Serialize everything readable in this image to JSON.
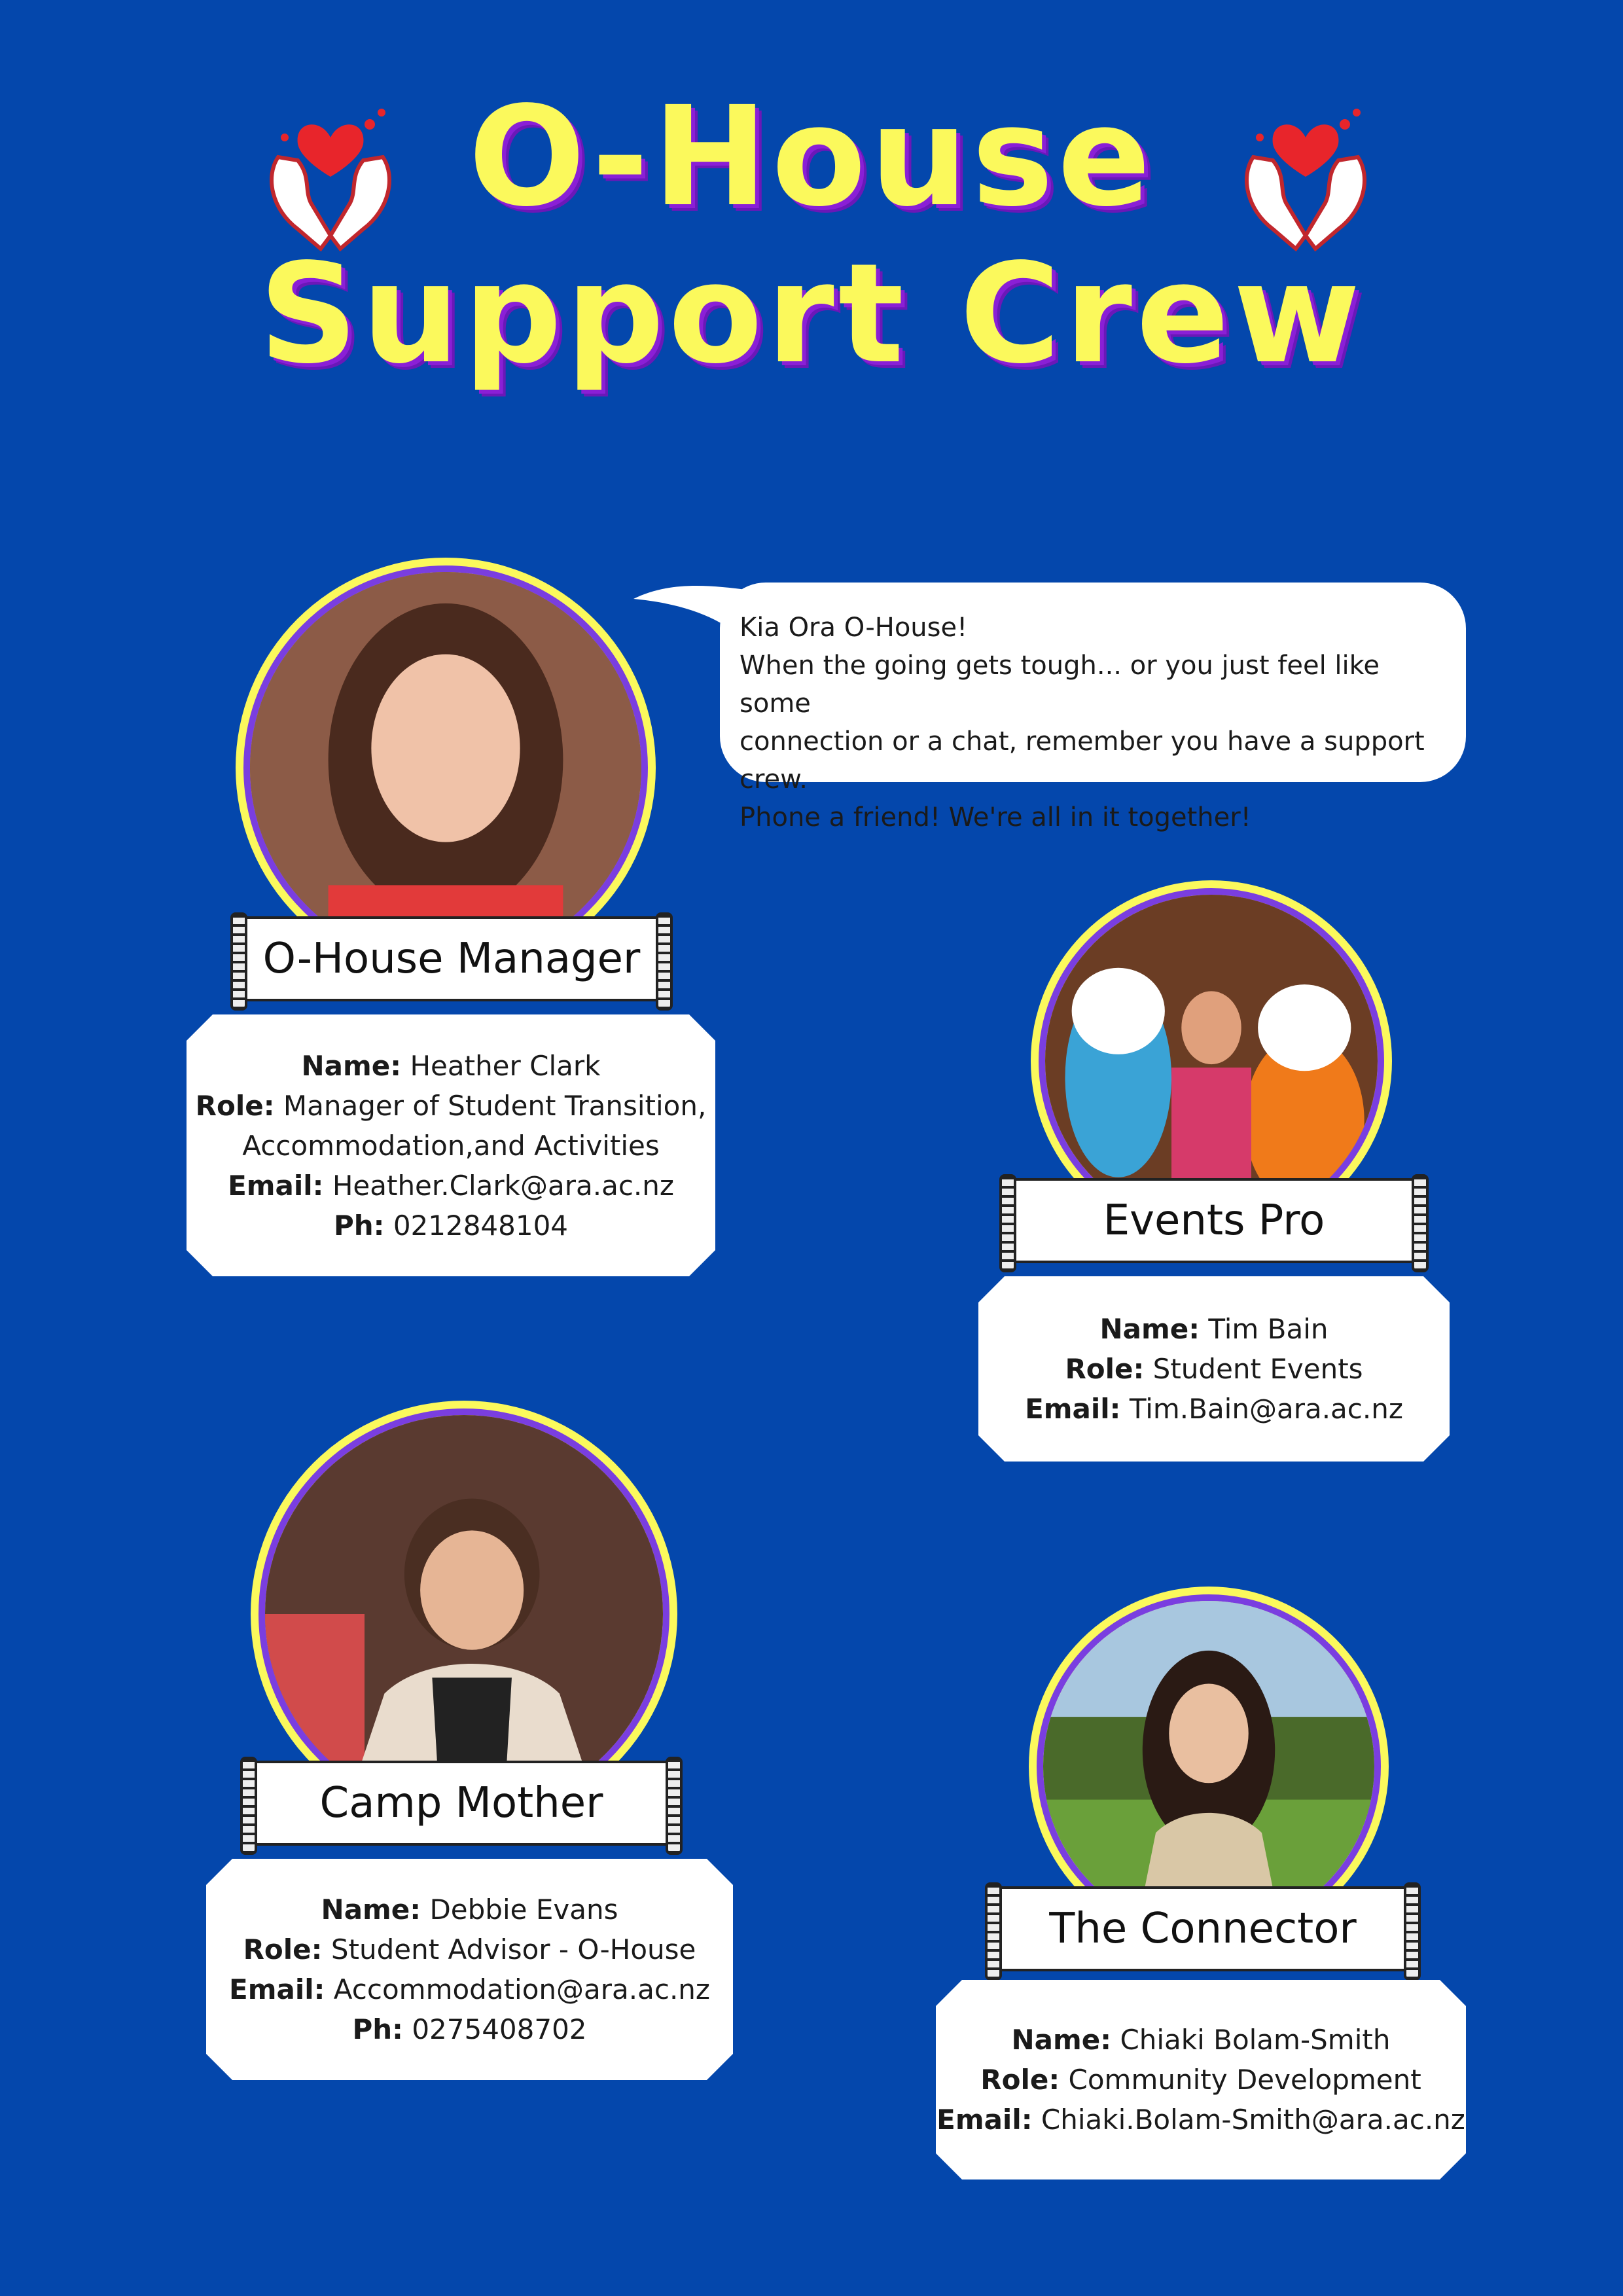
{
  "header": {
    "title_line1": "O-House",
    "title_line2": "Support Crew",
    "icon": "heart-hands-icon",
    "colors": {
      "background": "#0447ac",
      "title": "#fbf95c",
      "title_shadow": "#8a1fd6",
      "photo_ring": "#fbf95c"
    }
  },
  "speech_bubble": {
    "lines": [
      "Kia Ora O-House!",
      "When the going gets tough... or you just feel like some",
      "connection or a chat, remember you have a support crew.",
      "Phone a friend! We're all in it together!"
    ]
  },
  "crew": [
    {
      "banner": "O-House Manager",
      "name_label": "Name:",
      "name": "Heather Clark",
      "role_label": "Role:",
      "role_line1": "Manager of Student Transition,",
      "role_line2": "Accommodation,and Activities",
      "email_label": "Email:",
      "email": "Heather.Clark@ara.ac.nz",
      "phone_label": "Ph:",
      "phone": "0212848104"
    },
    {
      "banner": "Events Pro",
      "name_label": "Name:",
      "name": "Tim Bain",
      "role_label": "Role:",
      "role_line1": "Student Events",
      "email_label": "Email:",
      "email": "Tim.Bain@ara.ac.nz"
    },
    {
      "banner": "Camp Mother",
      "name_label": "Name:",
      "name": "Debbie Evans",
      "role_label": "Role:",
      "role_line1": "Student Advisor - O-House",
      "email_label": "Email:",
      "email": "Accommodation@ara.ac.nz",
      "phone_label": "Ph:",
      "phone": "0275408702"
    },
    {
      "banner": "The Connector",
      "name_label": "Name:",
      "name": "Chiaki Bolam-Smith",
      "role_label": "Role:",
      "role_line1": "Community Development",
      "email_label": "Email:",
      "email": "Chiaki.Bolam-Smith@ara.ac.nz"
    }
  ]
}
